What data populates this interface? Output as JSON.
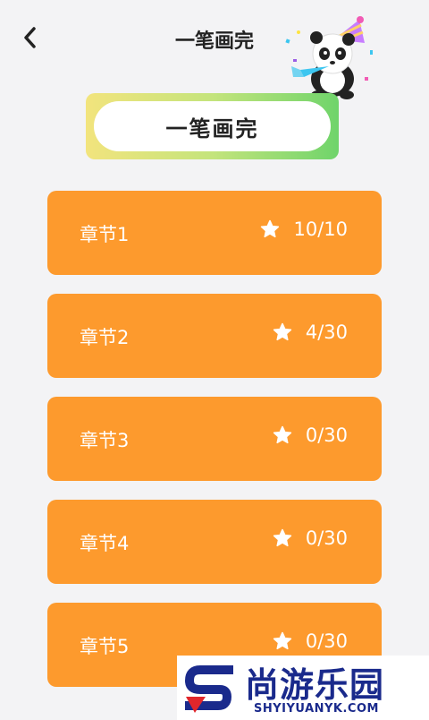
{
  "header": {
    "title": "一笔画完",
    "back_icon": "chevron-left-icon",
    "mascot": "panda-party-mascot"
  },
  "banner": {
    "title": "一笔画完"
  },
  "chapters": [
    {
      "name": "章节1",
      "score": "10/10"
    },
    {
      "name": "章节2",
      "score": "4/30"
    },
    {
      "name": "章节3",
      "score": "0/30"
    },
    {
      "name": "章节4",
      "score": "0/30"
    },
    {
      "name": "章节5",
      "score": "0/30"
    }
  ],
  "watermark": {
    "text_cn": "尚游乐园",
    "text_en": "SHYIYUANYK.COM"
  },
  "colors": {
    "background": "#f3f3f5",
    "chapter_card": "#fd9a2d",
    "banner_gradient_start": "#f2e47d",
    "banner_gradient_end": "#6fd46b",
    "watermark_blue": "#1a2a8c",
    "watermark_red": "#e0262b"
  }
}
